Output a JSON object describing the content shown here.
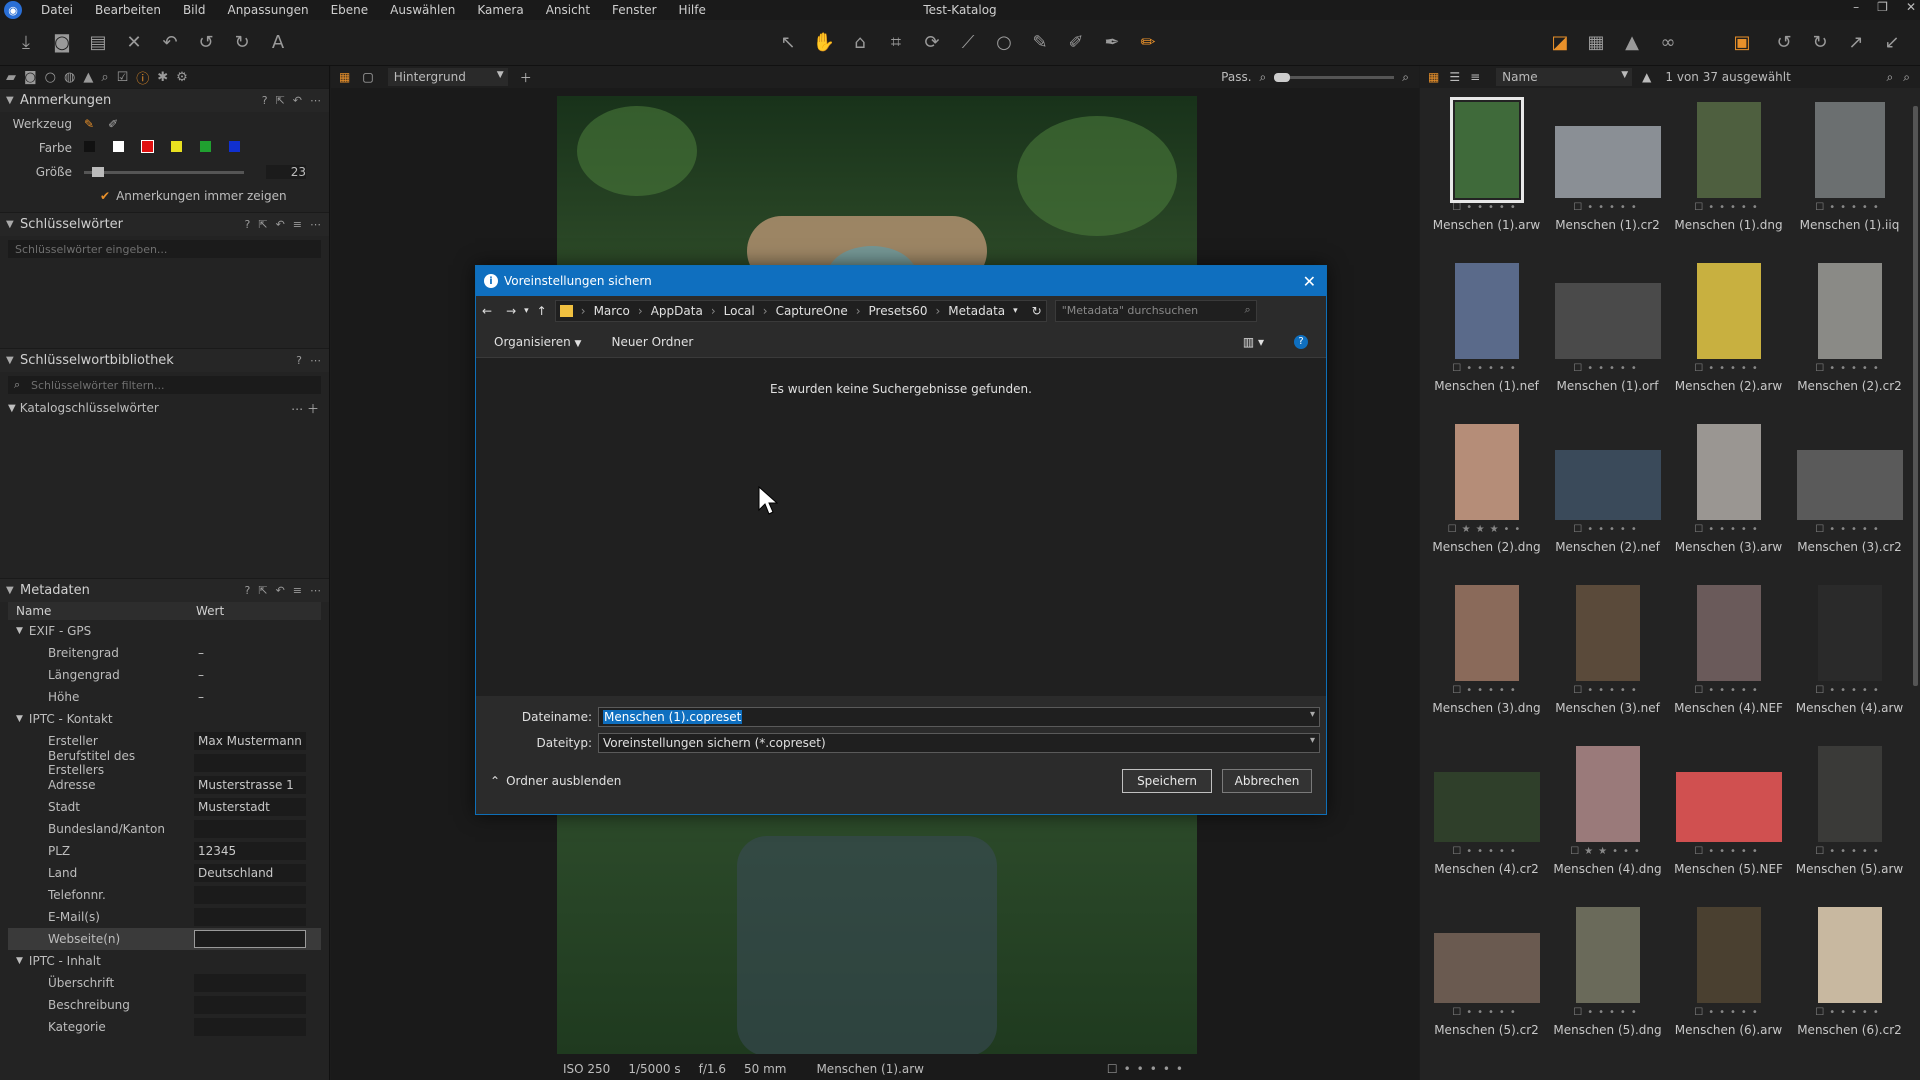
{
  "window": {
    "title": "Test-Katalog"
  },
  "menu": [
    "Datei",
    "Bearbeiten",
    "Bild",
    "Anpassungen",
    "Ebene",
    "Auswählen",
    "Kamera",
    "Ansicht",
    "Fenster",
    "Hilfe"
  ],
  "left": {
    "annotations": {
      "title": "Anmerkungen",
      "tool_label": "Werkzeug",
      "color_label": "Farbe",
      "size_label": "Größe",
      "size_value": "23",
      "always_show": "Anmerkungen immer zeigen",
      "colors": [
        "#111111",
        "#ffffff",
        "#e01010",
        "#e8e020",
        "#20a030",
        "#1030d0"
      ]
    },
    "keywords": {
      "title": "Schlüsselwörter",
      "placeholder": "Schlüsselwörter eingeben..."
    },
    "keyword_library": {
      "title": "Schlüsselwortbibliothek",
      "placeholder": "Schlüsselwörter filtern...",
      "catalog": "Katalogschlüsselwörter"
    },
    "metadata": {
      "title": "Metadaten",
      "col_name": "Name",
      "col_value": "Wert",
      "groups": [
        {
          "name": "EXIF - GPS",
          "rows": [
            [
              "Breitengrad",
              "–"
            ],
            [
              "Längengrad",
              "–"
            ],
            [
              "Höhe",
              "–"
            ]
          ]
        },
        {
          "name": "IPTC - Kontakt",
          "rows": [
            [
              "Ersteller",
              "Max Mustermann"
            ],
            [
              "Berufstitel des Erstellers",
              ""
            ],
            [
              "Adresse",
              "Musterstrasse 1"
            ],
            [
              "Stadt",
              "Musterstadt"
            ],
            [
              "Bundesland/Kanton",
              ""
            ],
            [
              "PLZ",
              "12345"
            ],
            [
              "Land",
              "Deutschland"
            ],
            [
              "Telefonnr.",
              ""
            ],
            [
              "E-Mail(s)",
              ""
            ],
            [
              "Webseite(n)",
              ""
            ]
          ]
        },
        {
          "name": "IPTC - Inhalt",
          "rows": [
            [
              "Überschrift",
              ""
            ],
            [
              "Beschreibung",
              ""
            ],
            [
              "Kategorie",
              ""
            ]
          ]
        }
      ]
    }
  },
  "viewer": {
    "layer": "Hintergrund",
    "fit_label": "Pass.",
    "status": {
      "iso": "ISO 250",
      "shutter": "1/5000 s",
      "aperture": "f/1.6",
      "focal": "50 mm",
      "file": "Menschen (1).arw"
    }
  },
  "browser": {
    "sort": "Name",
    "count": "1 von 37 ausgewählt",
    "items": [
      {
        "name": "Menschen (1).arw",
        "color": "#3f6a3a",
        "w": 64,
        "h": 96,
        "stars": 0,
        "selected": true
      },
      {
        "name": "Menschen (1).cr2",
        "color": "#8a8f95",
        "w": 106,
        "h": 72,
        "stars": 0
      },
      {
        "name": "Menschen (1).dng",
        "color": "#4e5f3f",
        "w": 64,
        "h": 96,
        "stars": 0
      },
      {
        "name": "Menschen (1).iiq",
        "color": "#6b6f70",
        "w": 70,
        "h": 96,
        "stars": 0
      },
      {
        "name": "Menschen (1).nef",
        "color": "#5a6a8a",
        "w": 64,
        "h": 96,
        "stars": 0
      },
      {
        "name": "Menschen (1).orf",
        "color": "#4a4a4a",
        "w": 106,
        "h": 76,
        "stars": 0
      },
      {
        "name": "Menschen (2).arw",
        "color": "#c8b040",
        "w": 64,
        "h": 96,
        "stars": 0
      },
      {
        "name": "Menschen (2).cr2",
        "color": "#8a8a86",
        "w": 64,
        "h": 96,
        "stars": 0
      },
      {
        "name": "Menschen (2).dng",
        "color": "#b58d78",
        "w": 64,
        "h": 96,
        "stars": 3
      },
      {
        "name": "Menschen (2).nef",
        "color": "#3a4a5a",
        "w": 106,
        "h": 70,
        "stars": 0
      },
      {
        "name": "Menschen (3).arw",
        "color": "#9a9692",
        "w": 64,
        "h": 96,
        "stars": 0
      },
      {
        "name": "Menschen (3).cr2",
        "color": "#5a5a5a",
        "w": 106,
        "h": 70,
        "stars": 0
      },
      {
        "name": "Menschen (3).dng",
        "color": "#8a6a5a",
        "w": 64,
        "h": 96,
        "stars": 0
      },
      {
        "name": "Menschen (3).nef",
        "color": "#5a4a3a",
        "w": 64,
        "h": 96,
        "stars": 0
      },
      {
        "name": "Menschen (4).NEF",
        "color": "#6a5a5a",
        "w": 64,
        "h": 96,
        "stars": 0
      },
      {
        "name": "Menschen (4).arw",
        "color": "#2a2a2a",
        "w": 64,
        "h": 96,
        "stars": 0
      },
      {
        "name": "Menschen (4).cr2",
        "color": "#2f3f2a",
        "w": 106,
        "h": 70,
        "stars": 0
      },
      {
        "name": "Menschen (4).dng",
        "color": "#9a7a7a",
        "w": 64,
        "h": 96,
        "stars": 2
      },
      {
        "name": "Menschen (5).NEF",
        "color": "#d05050",
        "w": 106,
        "h": 70,
        "stars": 0
      },
      {
        "name": "Menschen (5).arw",
        "color": "#3a3a38",
        "w": 64,
        "h": 96,
        "stars": 0
      },
      {
        "name": "Menschen (5).cr2",
        "color": "#6a5a50",
        "w": 106,
        "h": 70,
        "stars": 0
      },
      {
        "name": "Menschen (5).dng",
        "color": "#6a6a5a",
        "w": 64,
        "h": 96,
        "stars": 0
      },
      {
        "name": "Menschen (6).arw",
        "color": "#4a4030",
        "w": 64,
        "h": 96,
        "stars": 0
      },
      {
        "name": "Menschen (6).cr2",
        "color": "#c8b8a0",
        "w": 64,
        "h": 96,
        "stars": 0
      }
    ]
  },
  "dialog": {
    "title": "Voreinstellungen sichern",
    "crumbs": [
      "Marco",
      "AppData",
      "Local",
      "CaptureOne",
      "Presets60",
      "Metadata"
    ],
    "search_placeholder": "\"Metadata\" durchsuchen",
    "organize": "Organisieren",
    "new_folder": "Neuer Ordner",
    "empty_text": "Es wurden keine Suchergebnisse gefunden.",
    "filename_label": "Dateiname:",
    "filename_value": "Menschen (1).copreset",
    "filetype_label": "Dateityp:",
    "filetype_value": "Voreinstellungen sichern (*.copreset)",
    "hide_folders": "Ordner ausblenden",
    "save": "Speichern",
    "cancel": "Abbrechen"
  }
}
